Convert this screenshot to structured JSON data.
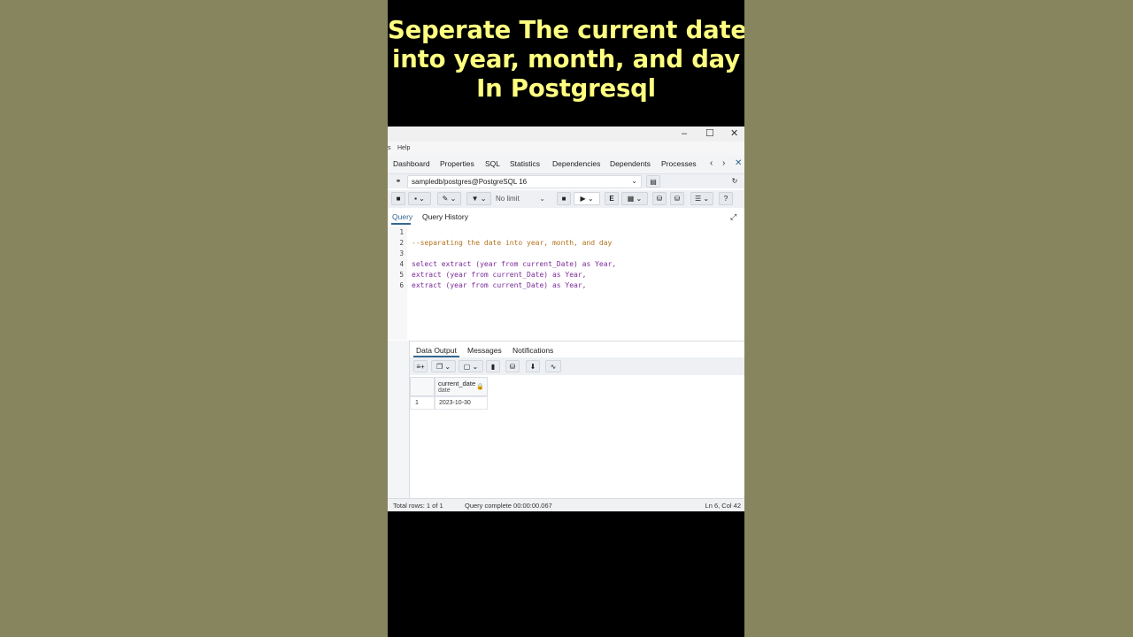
{
  "video_title": {
    "line1": "Seperate The current date",
    "line2": "into year, month, and day",
    "line3": "In Postgresql"
  },
  "window": {
    "minimize": "–",
    "maximize": "☐",
    "close": "✕"
  },
  "menu": {
    "partial": "s",
    "help": "Help"
  },
  "tabs": [
    "Dashboard",
    "Properties",
    "SQL",
    "Statistics",
    "Dependencies",
    "Dependents",
    "Processes"
  ],
  "connection": {
    "label": "sampledb/postgres@PostgreSQL 16"
  },
  "toolbar": {
    "limit": "No limit",
    "explain": "E"
  },
  "query_tabs": {
    "query": "Query",
    "history": "Query History"
  },
  "editor": {
    "line_numbers": [
      "1",
      "2",
      "3",
      "4",
      "5",
      "6"
    ],
    "lines": [
      "",
      "--separating the date into year, month, and day",
      "",
      "select extract (year from current_Date) as Year,",
      "extract (year from current_Date) as Year,",
      "extract (year from current_Date) as Year,"
    ]
  },
  "output_tabs": {
    "data_output": "Data Output",
    "messages": "Messages",
    "notifications": "Notifications"
  },
  "result": {
    "column_name": "current_date",
    "column_type": "date",
    "row_number": "1",
    "value": "2023-10-30"
  },
  "status": {
    "rows": "Total rows: 1 of 1",
    "complete": "Query complete 00:00:00.067",
    "cursor": "Ln 6, Col 42"
  }
}
